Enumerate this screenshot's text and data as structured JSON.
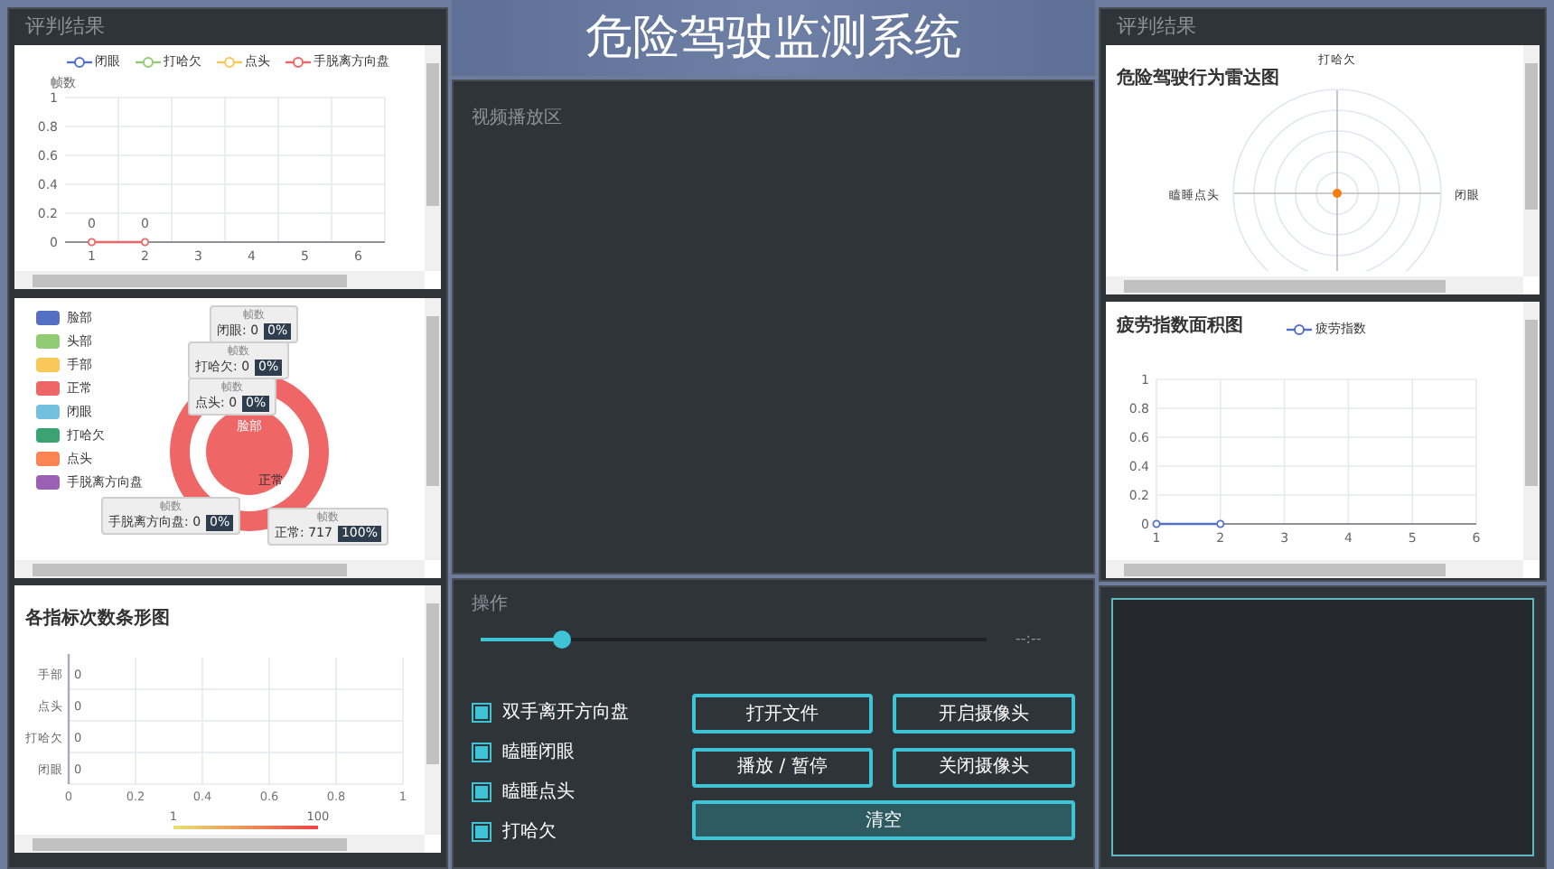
{
  "title": "危险驾驶监测系统",
  "left_panel": {
    "title": "评判结果",
    "line_chart": {
      "chart_data": {
        "type": "line",
        "ylabel": "帧数",
        "x": [
          1,
          2
        ],
        "xticks": [
          1,
          2,
          3,
          4,
          5,
          6
        ],
        "xlim": [
          0.5,
          6.5
        ],
        "yticks": [
          0,
          0.2,
          0.4,
          0.6,
          0.8,
          1
        ],
        "ylim": [
          0,
          1
        ],
        "grid": true,
        "data_labels": true,
        "series": [
          {
            "name": "闭眼",
            "color": "#5470c6",
            "marker": true,
            "values": [
              null,
              null
            ]
          },
          {
            "name": "打哈欠",
            "color": "#91cc75",
            "marker": true,
            "values": [
              null,
              null
            ]
          },
          {
            "name": "点头",
            "color": "#fac858",
            "marker": true,
            "values": [
              null,
              null
            ]
          },
          {
            "name": "手脱离方向盘",
            "color": "#ee6666",
            "marker": true,
            "values": [
              0,
              0
            ]
          }
        ]
      }
    },
    "pie_chart": {
      "legend": [
        {
          "label": "脸部",
          "color": "#5470c6"
        },
        {
          "label": "头部",
          "color": "#91cc75"
        },
        {
          "label": "手部",
          "color": "#fac858"
        },
        {
          "label": "正常",
          "color": "#ee6666"
        },
        {
          "label": "闭眼",
          "color": "#73c0de"
        },
        {
          "label": "打哈欠",
          "color": "#3ba272"
        },
        {
          "label": "点头",
          "color": "#fc8452"
        },
        {
          "label": "手脱离方向盘",
          "color": "#9a60b4"
        }
      ],
      "inner_label": "脸部",
      "outer_label": "正常",
      "tooltips": [
        {
          "title": "帧数",
          "label": "闭眼: 0",
          "percent": "0%"
        },
        {
          "title": "帧数",
          "label": "打哈欠: 0",
          "percent": "0%"
        },
        {
          "title": "帧数",
          "label": "点头: 0",
          "percent": "0%"
        },
        {
          "title": "帧数",
          "label": "手脱离方向盘: 0",
          "percent": "0%"
        },
        {
          "title": "帧数",
          "label": "正常: 717",
          "percent": "100%"
        }
      ]
    },
    "bar_chart": {
      "title": "各指标次数条形图",
      "chart_data": {
        "type": "bar",
        "orientation": "horizontal",
        "categories": [
          "手部",
          "点头",
          "打哈欠",
          "闭眼"
        ],
        "values": [
          0,
          0,
          0,
          0
        ],
        "xticks": [
          0,
          0.2,
          0.4,
          0.6,
          0.8,
          1
        ],
        "xlim": [
          0,
          1
        ],
        "grid": true,
        "data_labels": true
      },
      "visual_map": {
        "min": "1",
        "max": "100"
      }
    }
  },
  "center": {
    "video_area": {
      "label": "视频播放区"
    },
    "controls": {
      "title": "操作",
      "progress": {
        "level": 0.16
      },
      "time": "--:--",
      "checkboxes": [
        {
          "label": "双手离开方向盘",
          "checked": true
        },
        {
          "label": "瞌睡闭眼",
          "checked": true
        },
        {
          "label": "瞌睡点头",
          "checked": true
        },
        {
          "label": "打哈欠",
          "checked": true
        }
      ],
      "buttons": [
        {
          "label": "打开文件",
          "kind": "normal"
        },
        {
          "label": "开启摄像头",
          "kind": "normal"
        },
        {
          "label": "播放 / 暂停",
          "kind": "normal"
        },
        {
          "label": "关闭摄像头",
          "kind": "normal"
        },
        {
          "label": "清空",
          "kind": "wide"
        }
      ]
    }
  },
  "right_panel": {
    "title": "评判结果",
    "radar": {
      "title": "危险驾驶行为雷达图",
      "axes": [
        {
          "label": "打哈欠",
          "kind": "top"
        },
        {
          "label": "闭眼",
          "kind": "right"
        },
        {
          "label": "瞌睡点头",
          "kind": "left"
        }
      ]
    },
    "area_chart": {
      "title": "疲劳指数面积图",
      "chart_data": {
        "type": "line",
        "x": [
          1,
          2
        ],
        "xticks": [
          1,
          2,
          3,
          4,
          5,
          6
        ],
        "xlim": [
          1,
          6
        ],
        "yticks": [
          0,
          0.2,
          0.4,
          0.6,
          0.8,
          1
        ],
        "ylim": [
          0,
          1
        ],
        "grid": true,
        "series": [
          {
            "name": "疲劳指数",
            "color": "#5470c6",
            "marker": true,
            "values": [
              0,
              0
            ]
          }
        ]
      }
    }
  }
}
